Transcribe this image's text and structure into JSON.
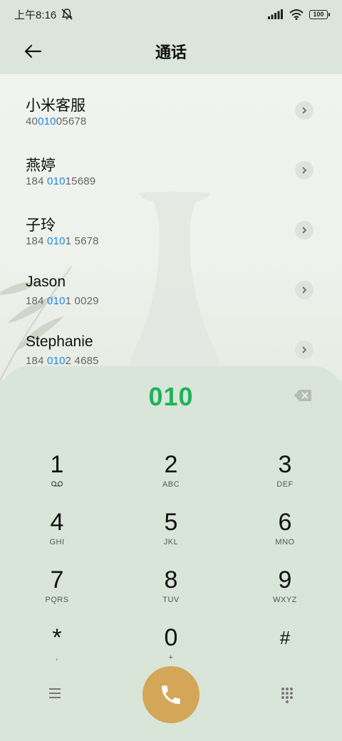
{
  "status": {
    "time": "上午8:16",
    "battery": "100"
  },
  "header": {
    "title": "通话"
  },
  "contacts": [
    {
      "name": "小米客服",
      "num_pre": "40",
      "num_hl": "010",
      "num_post": "05678"
    },
    {
      "name": "燕婷",
      "num_pre": "184 ",
      "num_hl": "010",
      "num_post": "15689"
    },
    {
      "name": "子玲",
      "num_pre": "184 ",
      "num_hl": "010",
      "num_post": "1 5678"
    },
    {
      "name": "Jason",
      "num_pre": "184 ",
      "num_hl": "010",
      "num_post": "1 0029"
    },
    {
      "name": "Stephanie",
      "num_pre": "184 ",
      "num_hl": "010",
      "num_post": "2 4685"
    }
  ],
  "dialpad": {
    "dialed": "010",
    "keys": [
      {
        "digit": "1",
        "letters": ""
      },
      {
        "digit": "2",
        "letters": "ABC"
      },
      {
        "digit": "3",
        "letters": "DEF"
      },
      {
        "digit": "4",
        "letters": "GHI"
      },
      {
        "digit": "5",
        "letters": "JKL"
      },
      {
        "digit": "6",
        "letters": "MNO"
      },
      {
        "digit": "7",
        "letters": "PQRS"
      },
      {
        "digit": "8",
        "letters": "TUV"
      },
      {
        "digit": "9",
        "letters": "WXYZ"
      },
      {
        "digit": "*",
        "letters": ","
      },
      {
        "digit": "0",
        "letters": "+"
      },
      {
        "digit": "#",
        "letters": ""
      }
    ]
  },
  "colors": {
    "accent_green": "#1fb35a",
    "highlight_blue": "#1e88e5",
    "call_button": "#d4a657"
  },
  "icons": [
    "back-arrow-icon",
    "mute-bell-icon",
    "signal-icon",
    "wifi-icon",
    "battery-icon",
    "chevron-right-icon",
    "backspace-icon",
    "voicemail-icon",
    "menu-icon",
    "phone-icon",
    "keypad-icon"
  ]
}
